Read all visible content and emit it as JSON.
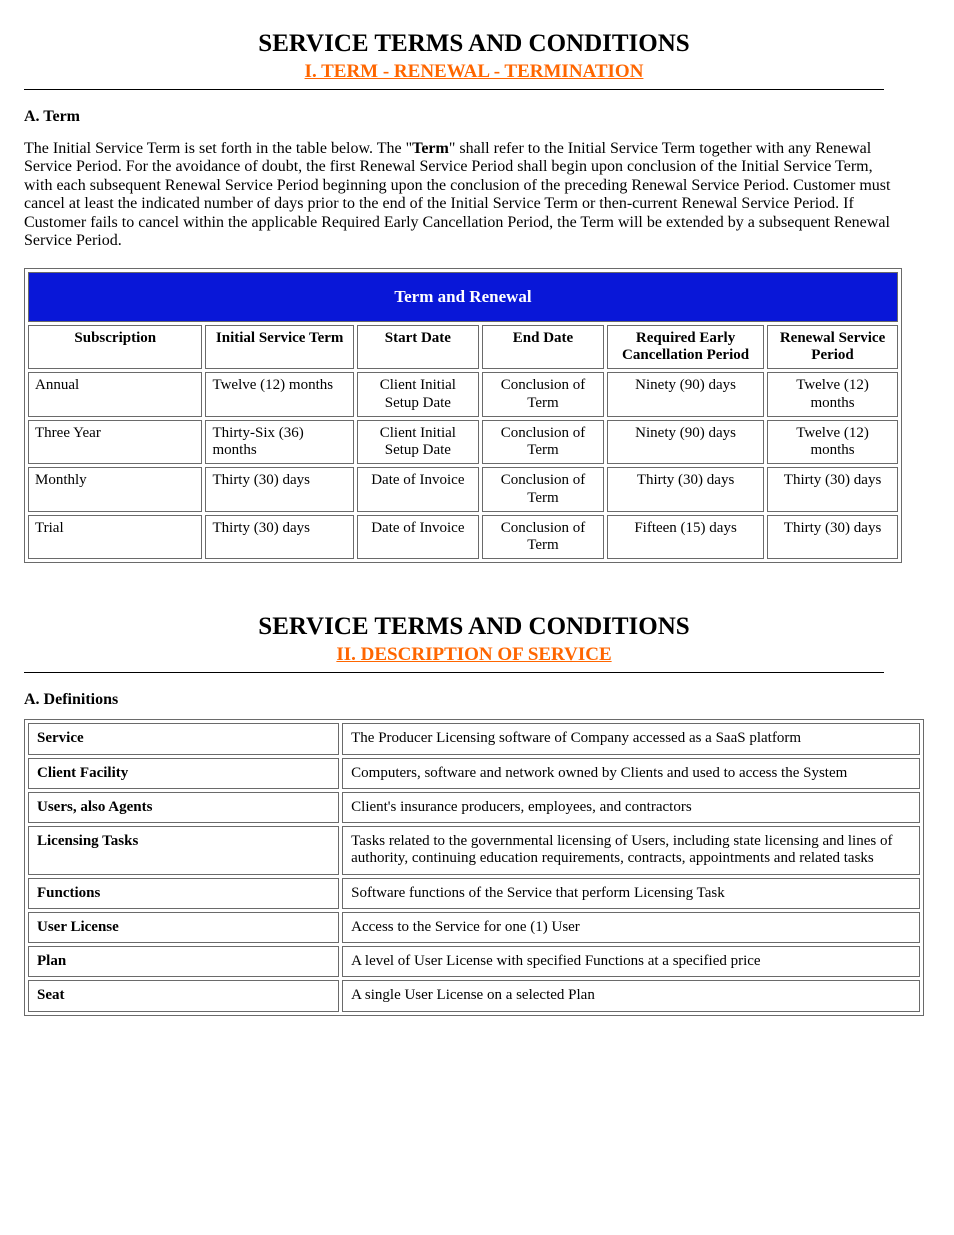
{
  "section1": {
    "heading": "SERVICE TERMS AND CONDITIONS",
    "subheading": "I. TERM - RENEWAL - TERMINATION",
    "lead": "A. Term",
    "para_prefix": "The Initial Service Term is set forth in the table below. The \"",
    "para_strong": "Term",
    "para_suffix": "\" shall refer to the Initial Service Term together with any Renewal Service Period. For the avoidance of doubt, the first Renewal Service Period shall begin upon conclusion of the Initial Service Term, with each subsequent Renewal Service Period beginning upon the conclusion of the preceding Renewal Service Period. Customer must cancel at least the indicated number of days prior to the end of the Initial Service Term or then-current Renewal Service Period. If Customer fails to cancel within the applicable Required Early Cancellation Period, the Term will be extended by a subsequent Renewal Service Period.",
    "table": {
      "banner": "Term and Renewal",
      "headers": [
        "Subscription",
        "Initial Service Term",
        "Start Date",
        "End Date",
        "Required Early Cancellation Period",
        "Renewal Service Period"
      ],
      "rows": [
        [
          "Annual",
          "Twelve (12) months",
          "Client Initial Setup Date",
          "Conclusion of Term",
          "Ninety (90) days",
          "Twelve (12) months"
        ],
        [
          "Three Year",
          "Thirty-Six (36) months",
          "Client Initial Setup Date",
          "Conclusion of Term",
          "Ninety (90) days",
          "Twelve (12) months"
        ],
        [
          "Monthly",
          "Thirty (30) days",
          "Date of Invoice",
          "Conclusion of Term",
          "Thirty (30) days",
          "Thirty (30) days"
        ],
        [
          "Trial",
          "Thirty (30) days",
          "Date of Invoice",
          "Conclusion of Term",
          "Fifteen (15) days",
          "Thirty (30) days"
        ]
      ]
    }
  },
  "section2": {
    "heading": "SERVICE TERMS AND CONDITIONS",
    "subheading": "II. DESCRIPTION OF SERVICE",
    "lead": "A. Definitions",
    "table": {
      "rows": [
        [
          "Service",
          "The Producer Licensing software of Company accessed as a SaaS platform"
        ],
        [
          "Client Facility",
          "Computers, software and network owned by Clients and used to access the System"
        ],
        [
          "Users, also Agents",
          "Client's insurance producers, employees, and contractors"
        ],
        [
          "Licensing Tasks",
          "Tasks related to the governmental licensing of Users, including state licensing and lines of authority, continuing education requirements, contracts, appointments and related tasks"
        ],
        [
          "Functions",
          "Software functions of the Service that perform Licensing Task"
        ],
        [
          "User License",
          "Access to the Service for one (1) User"
        ],
        [
          "Plan",
          "A level of User License with specified Functions at a specified price"
        ],
        [
          "Seat",
          "A single User License on a selected Plan"
        ]
      ]
    }
  }
}
